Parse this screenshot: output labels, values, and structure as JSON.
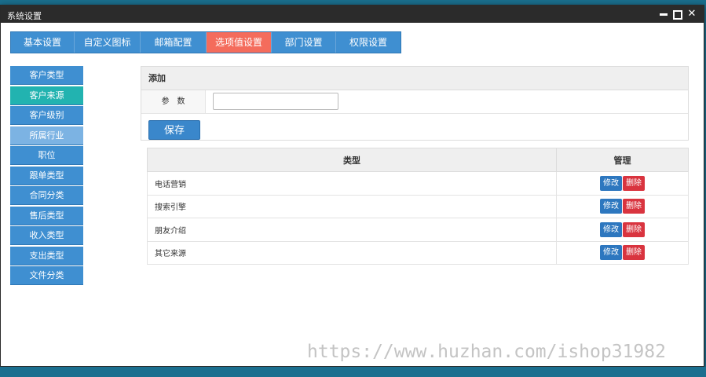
{
  "window": {
    "title": "系统设置"
  },
  "tabs": [
    {
      "label": "基本设置",
      "active": false
    },
    {
      "label": "自定义图标",
      "active": false
    },
    {
      "label": "邮箱配置",
      "active": false
    },
    {
      "label": "选项值设置",
      "active": true
    },
    {
      "label": "部门设置",
      "active": false
    },
    {
      "label": "权限设置",
      "active": false
    }
  ],
  "sidebar": {
    "items": [
      {
        "label": "客户类型"
      },
      {
        "label": "客户来源"
      },
      {
        "label": "客户级别"
      },
      {
        "label": "所属行业"
      },
      {
        "label": "职位"
      },
      {
        "label": "跟单类型"
      },
      {
        "label": "合同分类"
      },
      {
        "label": "售后类型"
      },
      {
        "label": "收入类型"
      },
      {
        "label": "支出类型"
      },
      {
        "label": "文件分类"
      }
    ],
    "active_index": 1
  },
  "add_form": {
    "header": "添加",
    "param_label": "参　数",
    "param_value": "",
    "save_label": "保存"
  },
  "table": {
    "headers": [
      "类型",
      "管理"
    ],
    "rows": [
      {
        "type": "电话营销",
        "edit": "修改",
        "delete": "删除"
      },
      {
        "type": "搜索引擎",
        "edit": "修改",
        "delete": "删除"
      },
      {
        "type": "朋友介绍",
        "edit": "修改",
        "delete": "删除"
      },
      {
        "type": "其它来源",
        "edit": "修改",
        "delete": "删除"
      }
    ]
  },
  "watermark": "https://www.huzhan.com/ishop31982",
  "colors": {
    "accent_blue": "#3f8fd1",
    "active_tab": "#f46c5c",
    "active_side": "#22b3b0",
    "delete_red": "#d9343f",
    "edit_blue": "#2d77bf",
    "titlebar": "#2b2b2b"
  }
}
